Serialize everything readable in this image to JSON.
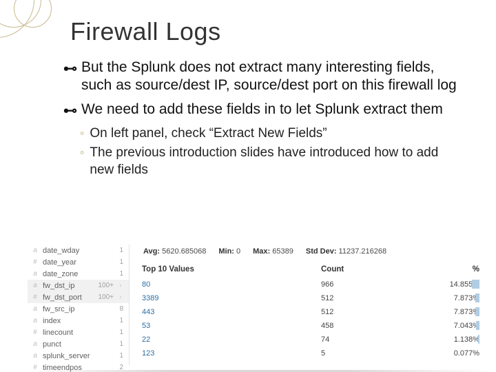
{
  "title": "Firewall Logs",
  "bullets": {
    "b1": "But the Splunk does not extract many interesting fields, such as source/dest IP, source/dest port on this firewall log",
    "b2": "We need to add these fields in to let Splunk extract them"
  },
  "subs": {
    "s1": "On left panel, check “Extract New Fields”",
    "s2": "The previous introduction slides have introduced how to add new fields"
  },
  "fields": {
    "f0": {
      "type": "a",
      "name": "date_wday",
      "count": "1"
    },
    "f1": {
      "type": "#",
      "name": "date_year",
      "count": "1"
    },
    "f2": {
      "type": "a",
      "name": "date_zone",
      "count": "1"
    },
    "f3": {
      "type": "a",
      "name": "fw_dst_ip",
      "count": "100+"
    },
    "f4": {
      "type": "#",
      "name": "fw_dst_port",
      "count": "100+"
    },
    "f5": {
      "type": "a",
      "name": "fw_src_ip",
      "count": "8"
    },
    "f6": {
      "type": "a",
      "name": "index",
      "count": "1"
    },
    "f7": {
      "type": "#",
      "name": "linecount",
      "count": "1"
    },
    "f8": {
      "type": "a",
      "name": "punct",
      "count": "1"
    },
    "f9": {
      "type": "a",
      "name": "splunk_server",
      "count": "1"
    },
    "f10": {
      "type": "#",
      "name": "timeendpos",
      "count": "2"
    }
  },
  "stats": {
    "avg_label": "Avg:",
    "avg": "5620.685068",
    "min_label": "Min:",
    "min": "0",
    "max_label": "Max:",
    "max": "65389",
    "std_label": "Std Dev:",
    "std": "11237.216268"
  },
  "topvals_header": {
    "c1": "Top 10 Values",
    "c2": "Count",
    "c3": "%"
  },
  "rows": {
    "r0": {
      "val": "80",
      "cnt": "966",
      "pct": "14.855%"
    },
    "r1": {
      "val": "3389",
      "cnt": "512",
      "pct": "7.873%"
    },
    "r2": {
      "val": "443",
      "cnt": "512",
      "pct": "7.873%"
    },
    "r3": {
      "val": "53",
      "cnt": "458",
      "pct": "7.043%"
    },
    "r4": {
      "val": "22",
      "cnt": "74",
      "pct": "1.138%"
    },
    "r5": {
      "val": "123",
      "cnt": "5",
      "pct": "0.077%"
    }
  }
}
